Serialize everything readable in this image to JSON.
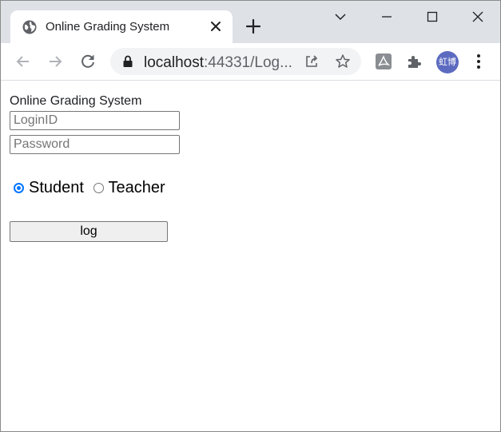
{
  "browser": {
    "tab_title": "Online Grading System",
    "url_host": "localhost",
    "url_path": ":44331/Log...",
    "profile_avatar_text": "虹博"
  },
  "icons": {
    "favicon": "globe-icon",
    "tab_close": "close-icon",
    "new_tab": "plus-icon",
    "tab_search": "chevron-down-icon",
    "minimize": "minimize-icon",
    "maximize": "maximize-icon",
    "close_window": "close-icon",
    "back": "arrow-left-icon",
    "forward": "arrow-right-icon",
    "reload": "reload-icon",
    "lock": "lock-icon",
    "share": "share-icon",
    "bookmark": "star-icon",
    "pdf_extension": "acrobat-icon",
    "extensions": "puzzle-icon",
    "menu": "kebab-menu-icon"
  },
  "colors": {
    "tabstrip_bg": "#dee1e6",
    "omnibox_bg": "#f1f3f4",
    "avatar_bg": "#5c6bc0",
    "radio_accent": "#0075ff"
  },
  "page": {
    "title": "Online Grading System",
    "login_placeholder": "LoginID",
    "password_placeholder": "Password",
    "role_options": [
      {
        "label": "Student",
        "selected": true
      },
      {
        "label": "Teacher",
        "selected": false
      }
    ],
    "submit_label": "log"
  }
}
